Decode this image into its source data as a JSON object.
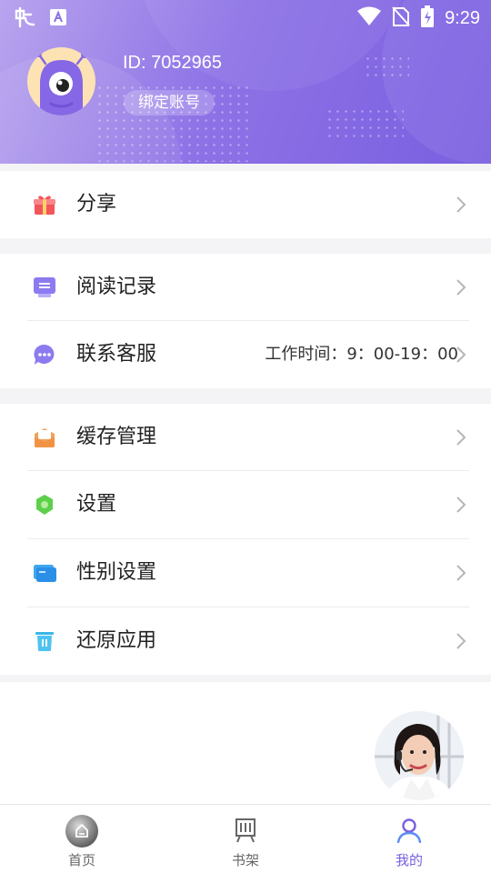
{
  "status_bar": {
    "time": "9:29"
  },
  "profile": {
    "user_id": "ID: 7052965",
    "bind_account": "绑定账号"
  },
  "menu": {
    "share": "分享",
    "reading_history": "阅读记录",
    "contact_service": "联系客服",
    "service_hours": "工作时间：9：00-19：00",
    "clear_cache": "缓存管理",
    "settings": "设置",
    "gender_settings": "性别设置",
    "restore_app": "还原应用"
  },
  "tabbar": {
    "home": "首页",
    "bookshelf": "书架",
    "mine": "我的"
  },
  "colors": {
    "accent": "#7a5fe0",
    "header_start": "#b8a4ee",
    "header_end": "#7a5fe0"
  }
}
